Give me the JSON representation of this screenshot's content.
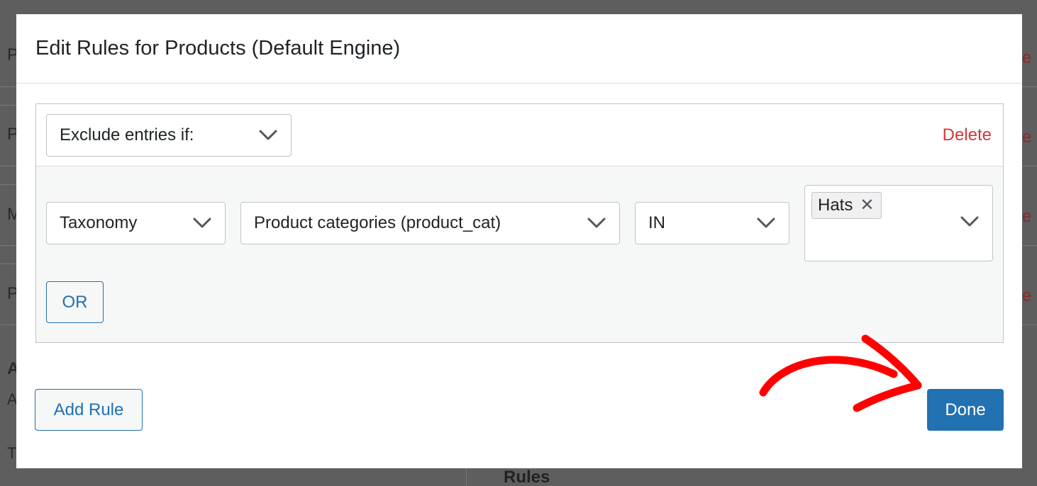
{
  "background": {
    "left_fragments": [
      "P",
      "P",
      "M",
      "P",
      "A",
      "A",
      "T"
    ],
    "right_fragment": "e",
    "rules_heading": "Rules"
  },
  "modal": {
    "title": "Edit Rules for Products (Default Engine)",
    "rule": {
      "mode_select": {
        "value": "Exclude entries if:"
      },
      "delete_label": "Delete",
      "condition": {
        "type_select": {
          "value": "Taxonomy"
        },
        "taxonomy_select": {
          "value": "Product categories (product_cat)"
        },
        "operator_select": {
          "value": "IN"
        },
        "terms": [
          {
            "label": "Hats",
            "remove_glyph": "✕"
          }
        ]
      },
      "or_label": "OR"
    },
    "add_rule_label": "Add Rule",
    "done_label": "Done"
  },
  "colors": {
    "accent": "#2271b1",
    "danger": "#d63638",
    "annotation": "#ff0000",
    "overlay": "#5e5e5e"
  },
  "icons": {
    "select_chevron": "chevron-down-icon",
    "tag_remove": "close-icon",
    "annotation": "red-arrow-icon"
  }
}
